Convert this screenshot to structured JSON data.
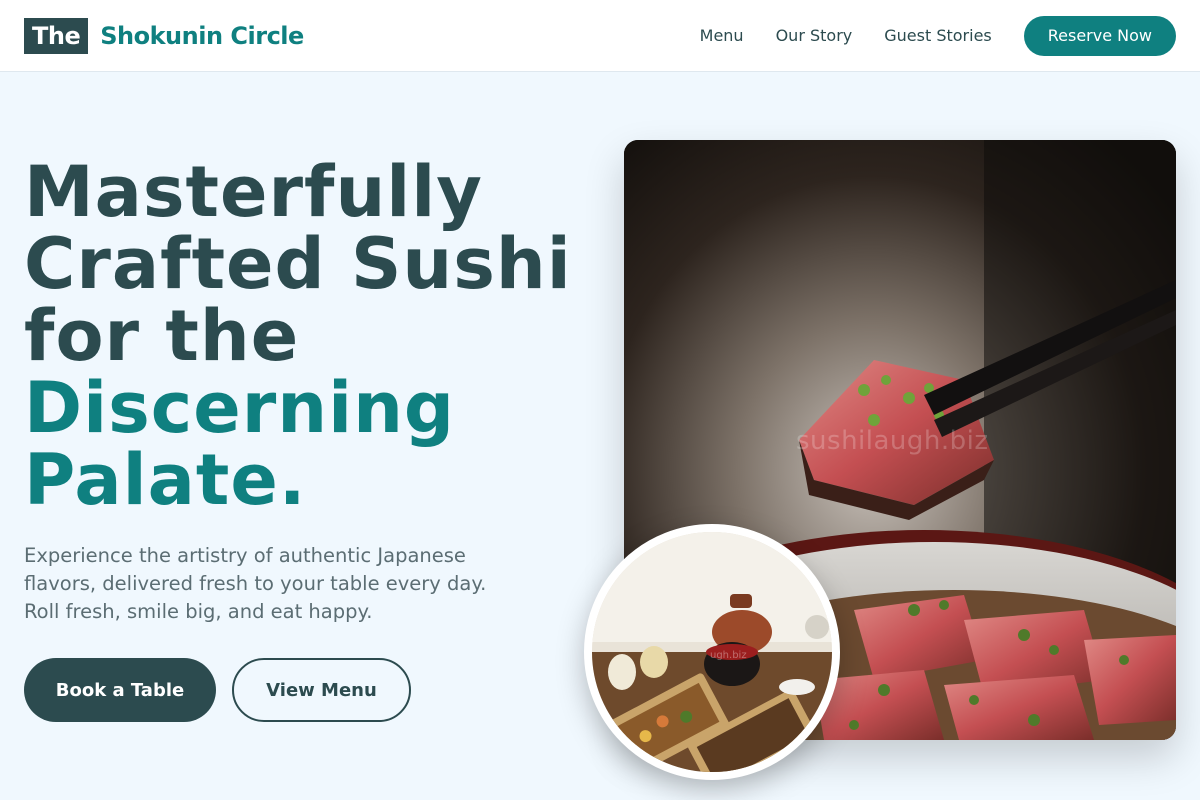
{
  "header": {
    "logo_mark": "The",
    "logo_name": "Shokunin Circle",
    "nav": [
      "Menu",
      "Our Story",
      "Guest Stories"
    ],
    "cta": "Reserve Now"
  },
  "hero": {
    "title_line1": "Masterfully",
    "title_line2": "Crafted Sushi",
    "title_line3": "for the",
    "title_accent": "Discerning",
    "title_line5": "Palate.",
    "subtitle": "Experience the artistry of authentic Japanese flavors, delivered fresh to your table every day. Roll fresh, smile big, and eat happy.",
    "primary_button": "Book a Table",
    "secondary_button": "View Menu",
    "image_watermark": "sushilaugh.biz",
    "inset_watermark": "ugh.biz"
  },
  "colors": {
    "primary_dark": "#2c4b4f",
    "accent_teal": "#0f8080",
    "background": "#f0f8fe"
  }
}
